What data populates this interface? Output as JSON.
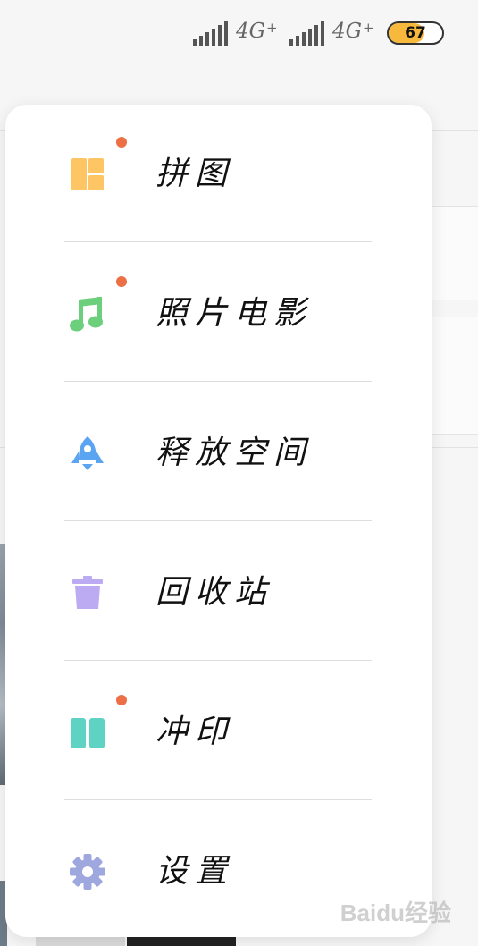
{
  "status_bar": {
    "network_1": "4G",
    "network_2": "4G",
    "network_plus": "+",
    "battery_level": "67",
    "battery_fraction": 0.67
  },
  "menu": {
    "items": [
      {
        "label": "拼图",
        "icon": "collage-icon",
        "color": "#fdc563",
        "has_dot": true
      },
      {
        "label": "照片电影",
        "icon": "music-note-icon",
        "color": "#6ccf7b",
        "has_dot": true
      },
      {
        "label": "释放空间",
        "icon": "rocket-icon",
        "color": "#5ba4f2",
        "has_dot": false
      },
      {
        "label": "回收站",
        "icon": "trash-icon",
        "color": "#bcaaf2",
        "has_dot": false
      },
      {
        "label": "冲印",
        "icon": "print-icon",
        "color": "#5fd3c3",
        "has_dot": true
      },
      {
        "label": "设置",
        "icon": "gear-icon",
        "color": "#9ea8de",
        "has_dot": false
      }
    ]
  },
  "watermark": "Baidu经验",
  "colors": {
    "badge_dot": "#ec6f45",
    "battery_fill": "#f6b93b"
  }
}
